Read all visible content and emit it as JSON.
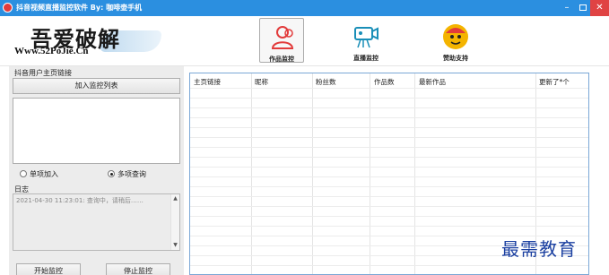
{
  "window": {
    "title": "抖音视频直播监控软件 By: 咖啡壶手机",
    "controls": {
      "minimize": "–",
      "close": "✕"
    }
  },
  "header": {
    "logo": {
      "main": "吾爱破解",
      "url": "Www.52PoJie.Cn"
    },
    "nav": [
      {
        "label": "作品监控",
        "icon": "users-icon",
        "active": true
      },
      {
        "label": "直播监控",
        "icon": "camera-icon",
        "active": false
      },
      {
        "label": "赞助支持",
        "icon": "character-icon",
        "active": false
      }
    ]
  },
  "left_panel": {
    "users_group_title": "抖音用户主页链接",
    "add_button": "加入监控列表",
    "url_list_value": "",
    "mode_options": [
      {
        "label": "单项加入",
        "checked": false
      },
      {
        "label": "多项查询",
        "checked": true
      }
    ],
    "log_title": "日志",
    "log_text": "2021-04-30 11:23:01: 查询中，请稍后……",
    "start_button": "开始监控",
    "stop_button": "停止监控"
  },
  "table": {
    "columns": [
      "主页链接",
      "昵称",
      "粉丝数",
      "作品数",
      "最新作品",
      "更新了*个"
    ],
    "rows": []
  },
  "watermark": "最需教育",
  "colors": {
    "titlebar": "#2b8fe0",
    "close_button": "#e04343",
    "table_border": "#7aa7d6",
    "watermark": "#1a3fa0"
  }
}
